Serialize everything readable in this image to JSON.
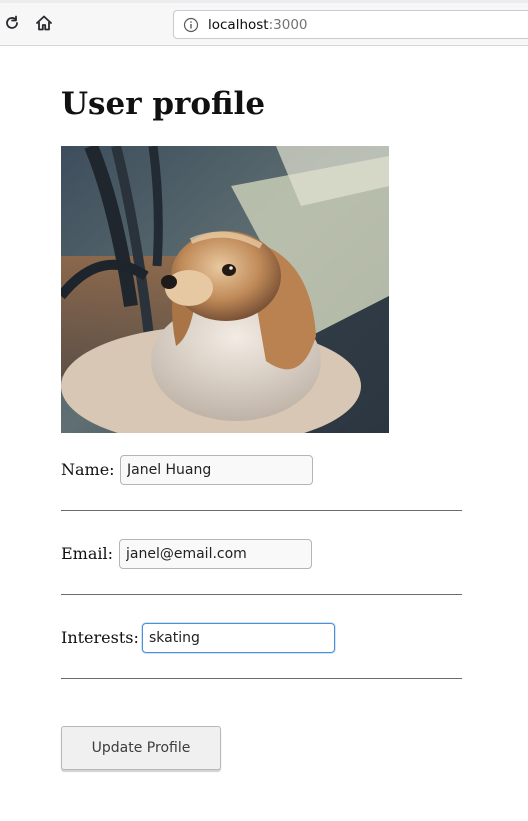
{
  "browser": {
    "url_host": "localhost",
    "url_port": ":3000"
  },
  "page": {
    "title": "User profile",
    "photo_alt": "Dog"
  },
  "form": {
    "name": {
      "label": "Name:",
      "value": "Janel Huang"
    },
    "email": {
      "label": "Email:",
      "value": "janel@email.com"
    },
    "interests": {
      "label": "Interests:",
      "value": "skating"
    },
    "submit_label": "Update Profile"
  },
  "colors": {
    "focus_border": "#4a90d9",
    "button_bg": "#f0f0f1"
  }
}
